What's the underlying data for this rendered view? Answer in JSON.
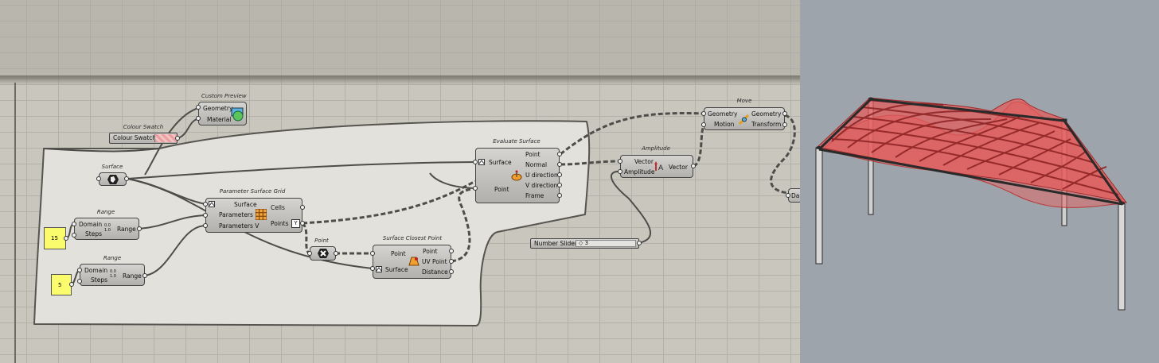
{
  "components": {
    "custom_preview": {
      "title": "Custom Preview",
      "inputs": [
        "Geometry",
        "Material"
      ]
    },
    "colour_swatch": {
      "title": "Colour Swatch",
      "label": "Colour Swatch",
      "color": "#e8a0a0"
    },
    "surface": {
      "title": "Surface"
    },
    "range1": {
      "title": "Range",
      "inputs": [
        "Domain",
        "Steps"
      ],
      "output": "Range",
      "domain_text": "0.0 1.0"
    },
    "range2": {
      "title": "Range",
      "inputs": [
        "Domain",
        "Steps"
      ],
      "output": "Range",
      "domain_text": "0.0 1.0"
    },
    "panel1": {
      "value": "15"
    },
    "panel2": {
      "value": "5"
    },
    "param_grid": {
      "title": "Parameter Surface Grid",
      "inputs": [
        "Surface",
        "Parameters U",
        "Parameters V"
      ],
      "outputs": [
        "Cells",
        "Points"
      ]
    },
    "point": {
      "title": "Point"
    },
    "closest_point": {
      "title": "Surface Closest Point",
      "inputs": [
        "Point",
        "Surface"
      ],
      "outputs": [
        "Point",
        "UV Point",
        "Distance"
      ]
    },
    "evaluate_surface": {
      "title": "Evaluate Surface",
      "inputs": [
        "Surface",
        "Point"
      ],
      "outputs": [
        "Point",
        "Normal",
        "U direction",
        "V direction",
        "Frame"
      ]
    },
    "amplitude": {
      "title": "Amplitude",
      "inputs": [
        "Vector",
        "Amplitude"
      ],
      "output": "Vector"
    },
    "number_slider": {
      "label": "Number Slider",
      "value": "◇ 3"
    },
    "move": {
      "title": "Move",
      "inputs": [
        "Geometry",
        "Motion"
      ],
      "outputs": [
        "Geometry",
        "Transform"
      ]
    },
    "partial": {
      "label": "Da"
    }
  },
  "colors": {
    "canvas": "#c9c7bd",
    "group": "#e3e1dc",
    "viewport_bg": "#9ea4ab",
    "surface_red": "#e05555"
  },
  "icons": [
    "surface-hexagon-icon",
    "grid-icon",
    "evaluate-icon",
    "closest-point-icon",
    "amplitude-icon",
    "move-icon",
    "preview-icon",
    "point-icon",
    "range-icon"
  ]
}
